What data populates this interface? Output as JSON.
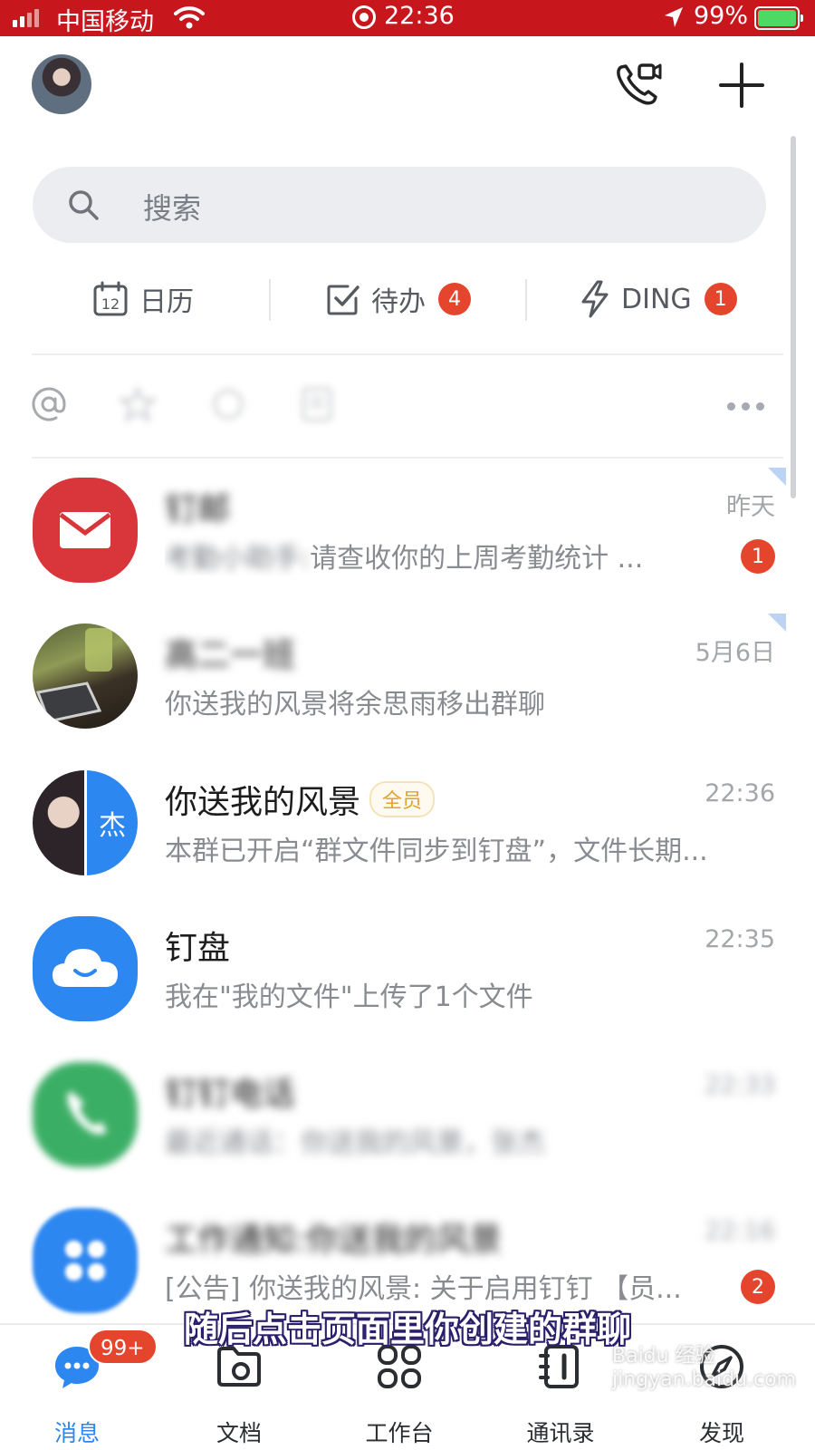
{
  "status_bar": {
    "carrier": "中国移动",
    "time": "22:36",
    "battery": "99%",
    "battery_level": 0.99
  },
  "search": {
    "placeholder": "搜索"
  },
  "shortcuts": [
    {
      "label": "日历",
      "icon": "calendar-icon",
      "icon_text": "12"
    },
    {
      "label": "待办",
      "icon": "todo-check-icon",
      "badge": "4"
    },
    {
      "label": "DING",
      "icon": "lightning-icon",
      "badge": "1"
    }
  ],
  "chats": [
    {
      "name": "钉邮",
      "time": "昨天",
      "preview_blur": "考勤小助手:",
      "preview": "请查收你的上周考勤统计 ...",
      "unread": "1",
      "pinned": true,
      "avatar": "mail-icon",
      "color": "#d9363c"
    },
    {
      "name": "高二一班",
      "time": "5月6日",
      "preview": "你送我的风景将余思雨移出群聊",
      "pinned": true,
      "avatar": "photo-avatar"
    },
    {
      "name": "你送我的风景",
      "tag": "全员",
      "time": "22:36",
      "preview": "本群已开启“群文件同步到钉盘”，文件长期...",
      "avatar_char": "杰",
      "avatar": "group-avatar"
    },
    {
      "name": "钉盘",
      "time": "22:35",
      "preview": "我在\"我的文件\"上传了1个文件",
      "avatar": "cloud-icon",
      "color": "#2d87f0"
    },
    {
      "name": "钉钉电话",
      "time": "22:33",
      "preview": "最近通话：你送我的风景，张杰",
      "avatar": "phone-icon",
      "color": "#1aa14b"
    },
    {
      "name": "工作通知:你送我的风景",
      "time": "22:16",
      "preview": "[公告] 你送我的风景: 关于启用钉钉 【员...",
      "unread": "2",
      "avatar": "workbench-icon",
      "color": "#2d87f0"
    }
  ],
  "nav": [
    {
      "label": "消息",
      "icon": "chat-bubble-icon",
      "active": true,
      "badge": "99+"
    },
    {
      "label": "文档",
      "icon": "folder-icon"
    },
    {
      "label": "工作台",
      "icon": "grid-icon"
    },
    {
      "label": "通讯录",
      "icon": "contacts-icon"
    },
    {
      "label": "发现",
      "icon": "compass-icon"
    }
  ],
  "subtitle": "随后点击页面里你创建的群聊",
  "watermark": "Baidu 经验 jingyan.baidu.com",
  "colors": {
    "accent": "#2d87f0",
    "badge": "#e6452d",
    "status_bar": "#c8161d"
  }
}
